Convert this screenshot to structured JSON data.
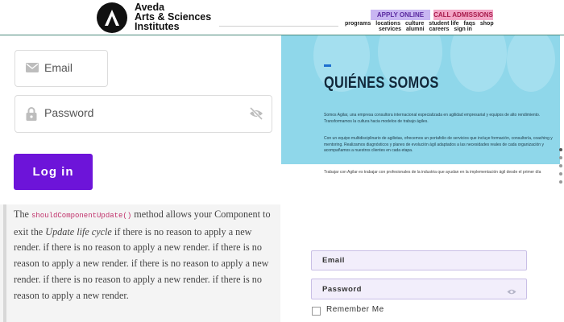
{
  "header": {
    "brand_line1": "Aveda",
    "brand_line2": "Arts & Sciences",
    "brand_line3": "Institutes",
    "apply_label": "APPLY ONLINE",
    "call_label": "CALL ADMISSIONS",
    "nav_row1": [
      "programs",
      "locations",
      "culture",
      "student life",
      "faqs",
      "shop"
    ],
    "nav_row2": [
      "services",
      "alumni",
      "careers",
      "sign in"
    ]
  },
  "login_left": {
    "email_placeholder": "Email",
    "password_placeholder": "Password",
    "login_label": "Log in"
  },
  "note": {
    "t1": "The ",
    "code": "shouldComponentUpdate()",
    "t2": " method allows your Component to exit the ",
    "em": "Update life cycle",
    "t3": " if there is no reason to apply a new render. if there is no reason to apply a new render. if there is no reason to apply a new render. if there is no reason to apply a new render. if there is no reason to apply a new render. if there is no reason to apply a new render."
  },
  "hero": {
    "title": "QUIÉNES SOMOS",
    "p1": "Somos Agilar, una empresa consultora internacional especializada en agilidad empresarial y equipos de alto rendimiento. Transformamos la cultura hacia modelos de trabajo ágiles.",
    "p2": "Con un equipo multidisciplinario de agilistas, ofrecemos un portafolio de servicios que incluye formación, consultoría, coaching y mentoring. Realizamos diagnósticos y planes de evolución ágil adaptados a las necesidades reales de cada organización y acompañamos a nuestros clientes en cada etapa.",
    "below": "Trabajar con Agilar es trabajar con profesionales de la industria que ayudan en la implementación ágil desde el primer día"
  },
  "login_right": {
    "email_label": "Email",
    "password_label": "Password",
    "remember_label": "Remember Me"
  },
  "colors": {
    "login_button": "#6d14d9",
    "apply_bg": "#c8b6f2",
    "call_bg": "#f3a6c6",
    "hero_bg": "#8fd7ea"
  }
}
